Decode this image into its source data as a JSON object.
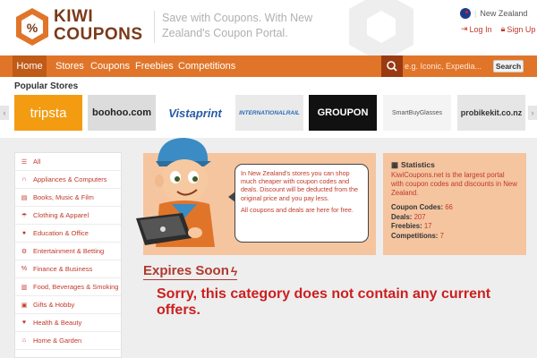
{
  "brand": {
    "line1": "KIWI",
    "line2": "COUPONS",
    "tagline": "Save with Coupons. With New Zealand's Coupon Portal."
  },
  "country": "New Zealand",
  "auth": {
    "login": "Log In",
    "signup": "Sign Up"
  },
  "nav": {
    "items": [
      "Home",
      "Stores",
      "Coupons",
      "Freebies",
      "Competitions"
    ],
    "active": "Home",
    "search_placeholder": "e.g. Iconic, Expedia...",
    "search_button": "Search"
  },
  "popular": {
    "title": "Popular Stores",
    "stores": [
      {
        "name": "tripsta",
        "bg": "#f39c12",
        "color": "#ffffff"
      },
      {
        "name": "boohoo.com",
        "bg": "#dcdcdc",
        "color": "#222222"
      },
      {
        "name": "Vistaprint",
        "bg": "#ffffff",
        "color": "#2a5ba8"
      },
      {
        "name": "INTERNATIONALRAIL",
        "bg": "#eaeaea",
        "color": "#2a6fb8"
      },
      {
        "name": "GROUPON",
        "bg": "#111111",
        "color": "#ffffff"
      },
      {
        "name": "SmartBuyGlasses",
        "bg": "#f4f4f4",
        "color": "#555555"
      },
      {
        "name": "probikekit.co.nz",
        "bg": "#e6e6e6",
        "color": "#333333"
      }
    ]
  },
  "categories": [
    {
      "label": "All",
      "icon": "list-icon"
    },
    {
      "label": "Appliances & Computers",
      "icon": "headphones-icon"
    },
    {
      "label": "Books, Music & Film",
      "icon": "book-icon"
    },
    {
      "label": "Clothing & Apparel",
      "icon": "umbrella-icon"
    },
    {
      "label": "Education & Office",
      "icon": "people-icon"
    },
    {
      "label": "Entertainment & Betting",
      "icon": "gear-icon"
    },
    {
      "label": "Finance & Business",
      "icon": "percent-icon"
    },
    {
      "label": "Food, Beverages & Smoking",
      "icon": "glass-icon"
    },
    {
      "label": "Gifts & Hobby",
      "icon": "gift-icon"
    },
    {
      "label": "Health & Beauty",
      "icon": "health-icon"
    },
    {
      "label": "Home & Garden",
      "icon": "home-icon"
    }
  ],
  "bubble": {
    "p1": "In New Zealand's stores you can shop much cheaper with coupon codes and deals. Discount will be deducted from the original price and you pay less.",
    "p2": "All coupons and deals are here for free."
  },
  "stats": {
    "title": "Statistics",
    "desc": "KiwiCoupons.net is the largest portal with coupon codes and discounts in New Zealand.",
    "rows": [
      {
        "label": "Coupon Codes:",
        "value": "66"
      },
      {
        "label": "Deals:",
        "value": "207"
      },
      {
        "label": "Freebies:",
        "value": "17"
      },
      {
        "label": "Competitions:",
        "value": "7"
      }
    ]
  },
  "expires_title": "Expires Soon",
  "empty_message": "Sorry, this category does not contain any current offers.",
  "colors": {
    "accent": "#e0752a",
    "dark_accent": "#bf5a17",
    "link_red": "#c0392b",
    "panel": "#f5c5a0"
  }
}
